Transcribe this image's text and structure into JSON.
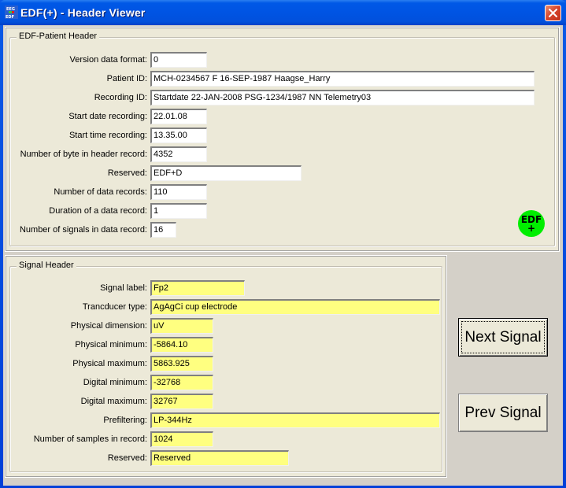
{
  "window": {
    "title": "EDF(+) - Header Viewer",
    "app_icon": "eeg-app-icon",
    "close_icon": "close-icon"
  },
  "patient_header": {
    "title": "EDF-Patient Header",
    "fields": [
      {
        "label": "Version data format:",
        "value": "0"
      },
      {
        "label": "Patient ID:",
        "value": "MCH-0234567 F 16-SEP-1987 Haagse_Harry"
      },
      {
        "label": "Recording ID:",
        "value": "Startdate 22-JAN-2008 PSG-1234/1987 NN Telemetry03"
      },
      {
        "label": "Start date recording:",
        "value": "22.01.08"
      },
      {
        "label": "Start time recording:",
        "value": "13.35.00"
      },
      {
        "label": "Number of byte in header record:",
        "value": "4352"
      },
      {
        "label": "Reserved:",
        "value": "EDF+D"
      },
      {
        "label": "Number of data records:",
        "value": "110"
      },
      {
        "label": "Duration of a data record:",
        "value": "1"
      },
      {
        "label": "Number of signals in data record:",
        "value": "16"
      }
    ],
    "logo": {
      "line1": "EDF",
      "line2": "+",
      "color": "#00ee00"
    }
  },
  "signal_header": {
    "title": "Signal Header",
    "fields": [
      {
        "label": "Signal label:",
        "value": "Fp2"
      },
      {
        "label": "Trancducer type:",
        "value": "AgAgCi cup electrode"
      },
      {
        "label": "Physical dimension:",
        "value": "uV"
      },
      {
        "label": "Physical minimum:",
        "value": "-5864.10"
      },
      {
        "label": "Physical maximum:",
        "value": "5863.925"
      },
      {
        "label": "Digital minimum:",
        "value": "-32768"
      },
      {
        "label": "Digital maximum:",
        "value": "32767"
      },
      {
        "label": "Prefiltering:",
        "value": "LP-344Hz"
      },
      {
        "label": "Number of samples in record:",
        "value": "1024"
      },
      {
        "label": "Reserved:",
        "value": "Reserved"
      }
    ],
    "field_color": "#ffff80"
  },
  "buttons": {
    "next_label": "Next Signal",
    "prev_label": "Prev Signal"
  }
}
